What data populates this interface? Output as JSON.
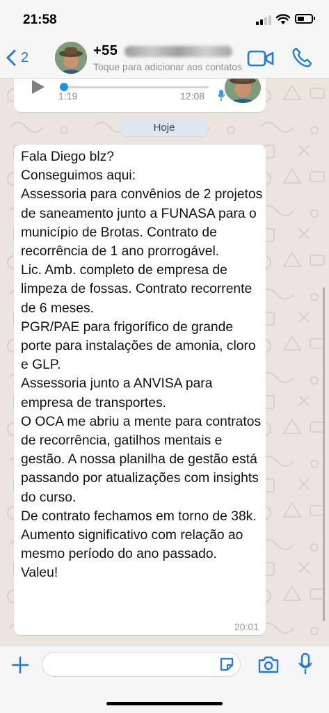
{
  "status_bar": {
    "time": "21:58"
  },
  "header": {
    "back_count": "2",
    "contact_name": "+55",
    "subtitle": "Toque para adicionar aos contatos"
  },
  "audio_message": {
    "duration": "1:19",
    "time": "12:08",
    "progress": 0
  },
  "date_chip": "Hoje",
  "message": {
    "text": "Fala Diego blz?\nConseguimos aqui:\nAssessoria para convênios de 2 projetos de saneamento junto a FUNASA para o município de Brotas. Contrato de recorrência de 1 ano prorrogável.\nLic. Amb. completo de empresa de limpeza de fossas. Contrato recorrente de 6 meses.\nPGR/PAE para frigorífico de grande porte para instalações de amonia, cloro e GLP.\nAssessoria junto a ANVISA para empresa de transportes.\nO OCA me abriu a mente para contratos de recorrência, gatilhos mentais e gestão. A nossa planilha de gestão está passando por atualizações com insights do curso.\nDe contrato fechamos em torno de 38k.  Aumento significativo com relação ao mesmo período do ano passado.\nValeu!",
    "time": "20:01"
  },
  "input_bar": {
    "placeholder": ""
  },
  "colors": {
    "accent": "#1f7ae0",
    "chat_background": "#ece5dd",
    "bubble": "#ffffff"
  },
  "icons": [
    "chevron-left-icon",
    "video-camera-icon",
    "phone-icon",
    "play-icon",
    "microphone-icon",
    "plus-icon",
    "sticker-icon",
    "camera-icon"
  ]
}
